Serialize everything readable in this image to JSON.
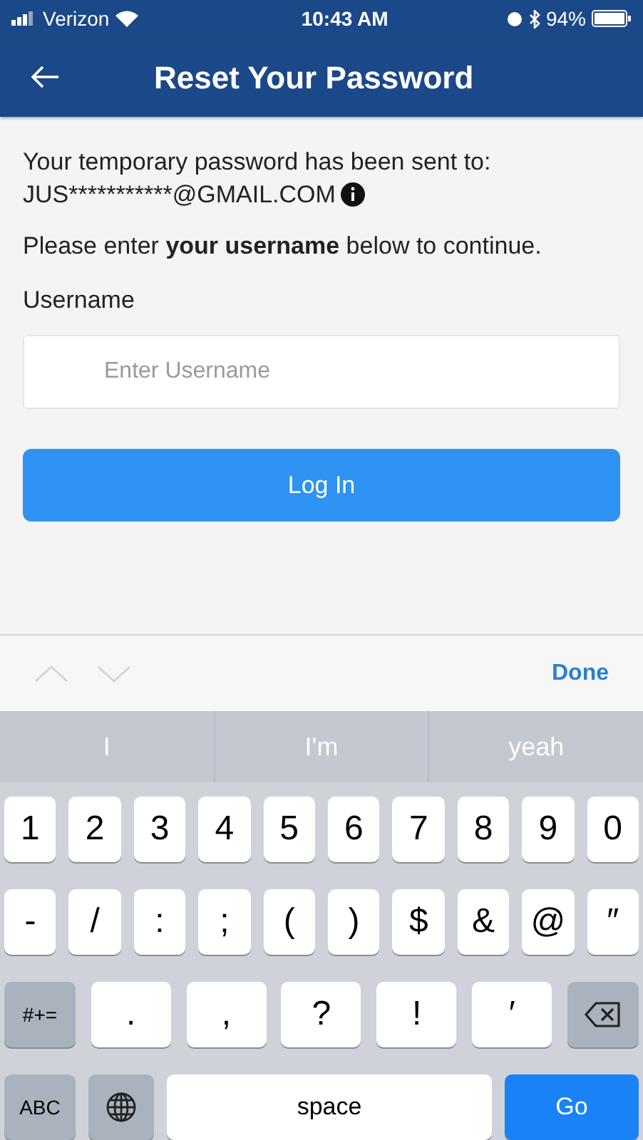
{
  "status_bar": {
    "carrier": "Verizon",
    "time": "10:43 AM",
    "battery": "94%"
  },
  "header": {
    "title": "Reset Your Password"
  },
  "message": {
    "line_1": "Your temporary password has been sent to:",
    "email": "JUS***********@GMAIL.COM"
  },
  "instruction": "Please enter **your username** below to continue.",
  "username_field": {
    "label": "Username",
    "placeholder": "Enter Username"
  },
  "login_button": "Log In",
  "keyboard_toolbar": {
    "done": "Done"
  },
  "suggestions": [
    "I",
    "I'm",
    "yeah"
  ],
  "keyboard_rows": [
    [
      {
        "kind": "char",
        "label": "1"
      },
      {
        "kind": "char",
        "label": "2"
      },
      {
        "kind": "char",
        "label": "3"
      },
      {
        "kind": "char",
        "label": "4"
      },
      {
        "kind": "char",
        "label": "5"
      },
      {
        "kind": "char",
        "label": "6"
      },
      {
        "kind": "char",
        "label": "7"
      },
      {
        "kind": "char",
        "label": "8"
      },
      {
        "kind": "char",
        "label": "9"
      },
      {
        "kind": "char",
        "label": "0"
      }
    ],
    [
      {
        "kind": "char",
        "label": "-"
      },
      {
        "kind": "char",
        "label": "/"
      },
      {
        "kind": "char",
        "label": ":"
      },
      {
        "kind": "char",
        "label": ";"
      },
      {
        "kind": "char",
        "label": "("
      },
      {
        "kind": "char",
        "label": ")"
      },
      {
        "kind": "char",
        "label": "$"
      },
      {
        "kind": "char",
        "label": "&"
      },
      {
        "kind": "char",
        "label": "@"
      },
      {
        "kind": "char",
        "label": "″"
      }
    ],
    [
      {
        "kind": "modifier",
        "label": "#+="
      },
      {
        "kind": "wide",
        "label": "."
      },
      {
        "kind": "wide",
        "label": ","
      },
      {
        "kind": "wide",
        "label": "?"
      },
      {
        "kind": "wide",
        "label": "!"
      },
      {
        "kind": "wide",
        "label": "′"
      },
      {
        "kind": "backspace"
      }
    ],
    [
      {
        "kind": "modifier",
        "label": "ABC"
      },
      {
        "kind": "globe"
      },
      {
        "kind": "space",
        "label": "space"
      },
      {
        "kind": "go",
        "label": "Go"
      }
    ]
  ]
}
